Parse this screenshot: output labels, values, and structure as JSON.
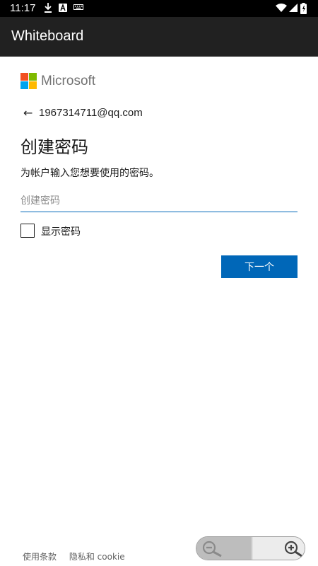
{
  "status_bar": {
    "time": "11:17",
    "icons": [
      "download-icon",
      "a-notification-icon",
      "keyboard-icon",
      "wifi-icon",
      "signal-icon",
      "battery-icon"
    ]
  },
  "app_bar": {
    "title": "Whiteboard"
  },
  "brand": {
    "logo_text": "Microsoft",
    "colors": {
      "red": "#f25022",
      "green": "#7fba00",
      "blue": "#00a4ef",
      "yellow": "#ffb900"
    }
  },
  "identity": {
    "email": "1967314711@qq.com",
    "back_icon": "back-arrow-icon"
  },
  "form": {
    "heading": "创建密码",
    "description": "为帐户输入您想要使用的密码。",
    "password_placeholder": "创建密码",
    "password_value": "",
    "show_password_label": "显示密码",
    "show_password_checked": false,
    "next_label": "下一个"
  },
  "footer": {
    "terms_label": "使用条款",
    "privacy_label": "隐私和 cookie"
  },
  "zoom": {
    "zoom_out_icon": "zoom-out-icon",
    "zoom_in_icon": "zoom-in-icon"
  },
  "theme": {
    "accent": "#0067b8",
    "app_bar": "#212121",
    "status_bar": "#000000"
  }
}
